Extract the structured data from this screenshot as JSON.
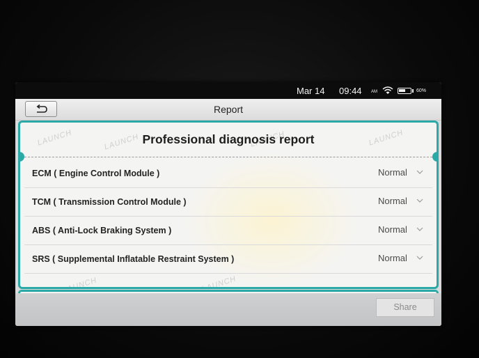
{
  "status_bar": {
    "date": "Mar 14",
    "time": "09:44",
    "ampm": "AM",
    "battery_text": "60%",
    "battery_level": 0.6
  },
  "header": {
    "title": "Report",
    "back_icon": "back-arrow-icon"
  },
  "report": {
    "heading": "Professional diagnosis report",
    "watermark_text": "LAUNCH",
    "modules": [
      {
        "name": "ECM ( Engine Control Module )",
        "status": "Normal"
      },
      {
        "name": "TCM ( Transmission Control Module )",
        "status": "Normal"
      },
      {
        "name": "ABS ( Anti-Lock Braking System )",
        "status": "Normal"
      },
      {
        "name": "SRS ( Supplemental Inflatable Restraint System )",
        "status": "Normal"
      }
    ]
  },
  "footer": {
    "share_label": "Share"
  },
  "colors": {
    "accent": "#2aa9a6"
  }
}
